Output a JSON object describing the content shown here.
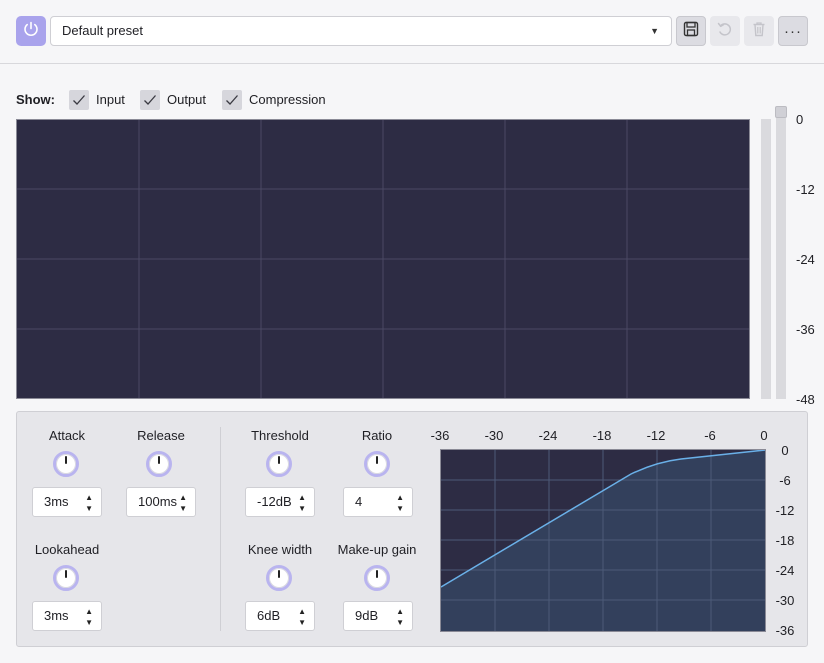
{
  "toolbar": {
    "preset_value": "Default preset",
    "more_label": "···"
  },
  "show": {
    "label": "Show:",
    "options": [
      {
        "label": "Input",
        "checked": true
      },
      {
        "label": "Output",
        "checked": true
      },
      {
        "label": "Compression",
        "checked": true
      }
    ]
  },
  "meter_scale": [
    "0",
    "-12",
    "-24",
    "-36",
    "-48"
  ],
  "controls": {
    "attack": {
      "label": "Attack",
      "value": "3ms"
    },
    "release": {
      "label": "Release",
      "value": "100ms"
    },
    "lookahead": {
      "label": "Lookahead",
      "value": "3ms"
    },
    "threshold": {
      "label": "Threshold",
      "value": "-12dB"
    },
    "ratio": {
      "label": "Ratio",
      "value": "4"
    },
    "knee_width": {
      "label": "Knee width",
      "value": "6dB"
    },
    "makeup_gain": {
      "label": "Make-up gain",
      "value": "9dB"
    }
  },
  "curve_graph": {
    "x_ticks": [
      "-36",
      "-30",
      "-24",
      "-18",
      "-12",
      "-6",
      "0"
    ],
    "y_ticks": [
      "0",
      "-6",
      "-12",
      "-18",
      "-24",
      "-30",
      "-36"
    ]
  },
  "colors": {
    "accent": "#a9a3ec",
    "graph_bg": "#2d2c44",
    "curve_line": "#6ab0e8",
    "curve_fill": "#33405c"
  }
}
